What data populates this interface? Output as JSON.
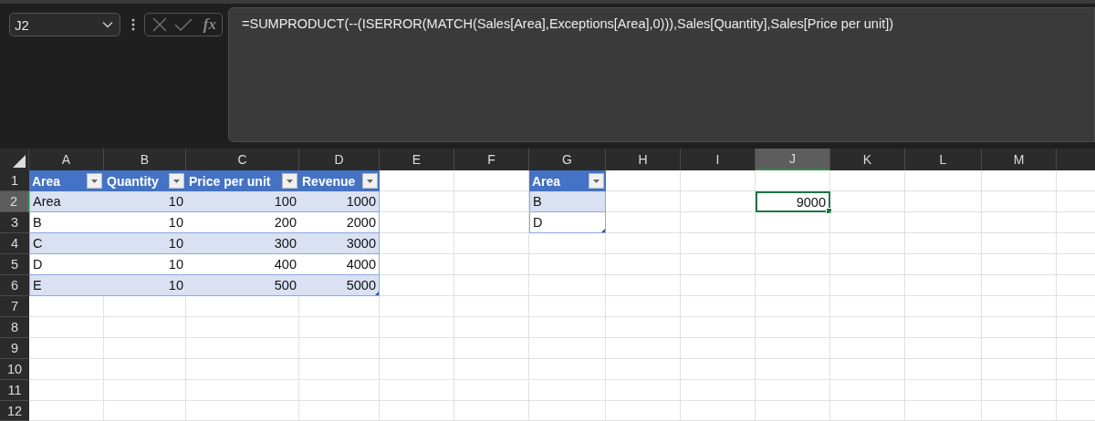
{
  "formula_bar": {
    "name_box": "J2",
    "function_label": "fx",
    "formula": "=SUMPRODUCT(--(ISERROR(MATCH(Sales[Area],Exceptions[Area],0))),Sales[Quantity],Sales[Price per unit])"
  },
  "sheet": {
    "columns": [
      {
        "label": "A",
        "selected": false
      },
      {
        "label": "B",
        "selected": false
      },
      {
        "label": "C",
        "selected": false
      },
      {
        "label": "D",
        "selected": false
      },
      {
        "label": "E",
        "selected": false
      },
      {
        "label": "F",
        "selected": false
      },
      {
        "label": "G",
        "selected": false
      },
      {
        "label": "H",
        "selected": false
      },
      {
        "label": "I",
        "selected": false
      },
      {
        "label": "J",
        "selected": true
      },
      {
        "label": "K",
        "selected": false
      },
      {
        "label": "L",
        "selected": false
      },
      {
        "label": "M",
        "selected": false
      },
      {
        "selected": false
      }
    ],
    "rows": [
      {
        "label": "1",
        "selected": false,
        "cells": [
          {
            "kind": "header",
            "text": "Area",
            "selected": false
          },
          {
            "kind": "header",
            "text": "Quantity",
            "selected": false
          },
          {
            "kind": "header",
            "text": "Price per unit",
            "selected": false
          },
          {
            "kind": "header",
            "text": "Revenue",
            "selected": false
          },
          {
            "kind": "blank",
            "selected": false
          },
          {
            "kind": "blank",
            "selected": false
          },
          {
            "kind": "header",
            "text": "Area",
            "selected": false
          },
          {
            "kind": "blank",
            "selected": false
          },
          {
            "kind": "blank",
            "selected": false
          },
          {
            "kind": "blank",
            "selected": false
          },
          {
            "kind": "blank",
            "selected": false
          },
          {
            "kind": "blank",
            "selected": false
          },
          {
            "kind": "blank",
            "selected": false
          },
          {
            "kind": "blank",
            "selected": false
          }
        ]
      },
      {
        "label": "2",
        "selected": true,
        "cells": [
          {
            "kind": "text",
            "text": "Area",
            "band": true,
            "selected": false
          },
          {
            "kind": "number",
            "text": "10",
            "band": true,
            "selected": false
          },
          {
            "kind": "number",
            "text": "100",
            "band": true,
            "selected": false
          },
          {
            "kind": "number",
            "text": "1000",
            "band": true,
            "selected": false
          },
          {
            "kind": "blank",
            "selected": false
          },
          {
            "kind": "blank",
            "selected": false
          },
          {
            "kind": "text",
            "text": "B",
            "band": true,
            "selected": false
          },
          {
            "kind": "blank",
            "selected": false
          },
          {
            "kind": "blank",
            "selected": false
          },
          {
            "kind": "number",
            "text": "9000",
            "selected": true
          },
          {
            "kind": "blank",
            "selected": false
          },
          {
            "kind": "blank",
            "selected": false
          },
          {
            "kind": "blank",
            "selected": false
          },
          {
            "kind": "blank",
            "selected": false
          }
        ]
      },
      {
        "label": "3",
        "selected": false,
        "cells": [
          {
            "kind": "text",
            "text": "B",
            "band": false,
            "selected": false
          },
          {
            "kind": "number",
            "text": "10",
            "band": false,
            "selected": false
          },
          {
            "kind": "number",
            "text": "200",
            "band": false,
            "selected": false
          },
          {
            "kind": "number",
            "text": "2000",
            "band": false,
            "selected": false
          },
          {
            "kind": "blank",
            "selected": false
          },
          {
            "kind": "blank",
            "selected": false
          },
          {
            "kind": "text",
            "text": "D",
            "band": false,
            "selected": false
          },
          {
            "kind": "blank",
            "selected": false
          },
          {
            "kind": "blank",
            "selected": false
          },
          {
            "kind": "blank",
            "selected": false
          },
          {
            "kind": "blank",
            "selected": false
          },
          {
            "kind": "blank",
            "selected": false
          },
          {
            "kind": "blank",
            "selected": false
          },
          {
            "kind": "blank",
            "selected": false
          }
        ]
      },
      {
        "label": "4",
        "selected": false,
        "cells": [
          {
            "kind": "text",
            "text": "C",
            "band": true,
            "selected": false
          },
          {
            "kind": "number",
            "text": "10",
            "band": true,
            "selected": false
          },
          {
            "kind": "number",
            "text": "300",
            "band": true,
            "selected": false
          },
          {
            "kind": "number",
            "text": "3000",
            "band": true,
            "selected": false
          },
          {
            "kind": "blank",
            "selected": false
          },
          {
            "kind": "blank",
            "selected": false
          },
          {
            "kind": "blank",
            "selected": false
          },
          {
            "kind": "blank",
            "selected": false
          },
          {
            "kind": "blank",
            "selected": false
          },
          {
            "kind": "blank",
            "selected": false
          },
          {
            "kind": "blank",
            "selected": false
          },
          {
            "kind": "blank",
            "selected": false
          },
          {
            "kind": "blank",
            "selected": false
          },
          {
            "kind": "blank",
            "selected": false
          }
        ]
      },
      {
        "label": "5",
        "selected": false,
        "cells": [
          {
            "kind": "text",
            "text": "D",
            "band": false,
            "selected": false
          },
          {
            "kind": "number",
            "text": "10",
            "band": false,
            "selected": false
          },
          {
            "kind": "number",
            "text": "400",
            "band": false,
            "selected": false
          },
          {
            "kind": "number",
            "text": "4000",
            "band": false,
            "selected": false
          },
          {
            "kind": "blank",
            "selected": false
          },
          {
            "kind": "blank",
            "selected": false
          },
          {
            "kind": "blank",
            "selected": false
          },
          {
            "kind": "blank",
            "selected": false
          },
          {
            "kind": "blank",
            "selected": false
          },
          {
            "kind": "blank",
            "selected": false
          },
          {
            "kind": "blank",
            "selected": false
          },
          {
            "kind": "blank",
            "selected": false
          },
          {
            "kind": "blank",
            "selected": false
          },
          {
            "kind": "blank",
            "selected": false
          }
        ]
      },
      {
        "label": "6",
        "selected": false,
        "cells": [
          {
            "kind": "text",
            "text": "E",
            "band": true,
            "selected": false
          },
          {
            "kind": "number",
            "text": "10",
            "band": true,
            "selected": false
          },
          {
            "kind": "number",
            "text": "500",
            "band": true,
            "selected": false
          },
          {
            "kind": "number",
            "text": "5000",
            "band": true,
            "selected": false
          },
          {
            "kind": "blank",
            "selected": false
          },
          {
            "kind": "blank",
            "selected": false
          },
          {
            "kind": "blank",
            "selected": false
          },
          {
            "kind": "blank",
            "selected": false
          },
          {
            "kind": "blank",
            "selected": false
          },
          {
            "kind": "blank",
            "selected": false
          },
          {
            "kind": "blank",
            "selected": false
          },
          {
            "kind": "blank",
            "selected": false
          },
          {
            "kind": "blank",
            "selected": false
          },
          {
            "kind": "blank",
            "selected": false
          }
        ]
      },
      {
        "label": "7",
        "selected": false,
        "cells": [
          {
            "kind": "blank",
            "selected": false
          },
          {
            "kind": "blank",
            "selected": false
          },
          {
            "kind": "blank",
            "selected": false
          },
          {
            "kind": "blank",
            "selected": false
          },
          {
            "kind": "blank",
            "selected": false
          },
          {
            "kind": "blank",
            "selected": false
          },
          {
            "kind": "blank",
            "selected": false
          },
          {
            "kind": "blank",
            "selected": false
          },
          {
            "kind": "blank",
            "selected": false
          },
          {
            "kind": "blank",
            "selected": false
          },
          {
            "kind": "blank",
            "selected": false
          },
          {
            "kind": "blank",
            "selected": false
          },
          {
            "kind": "blank",
            "selected": false
          },
          {
            "kind": "blank",
            "selected": false
          }
        ]
      },
      {
        "label": "8",
        "selected": false,
        "cells": [
          {
            "kind": "blank",
            "selected": false
          },
          {
            "kind": "blank",
            "selected": false
          },
          {
            "kind": "blank",
            "selected": false
          },
          {
            "kind": "blank",
            "selected": false
          },
          {
            "kind": "blank",
            "selected": false
          },
          {
            "kind": "blank",
            "selected": false
          },
          {
            "kind": "blank",
            "selected": false
          },
          {
            "kind": "blank",
            "selected": false
          },
          {
            "kind": "blank",
            "selected": false
          },
          {
            "kind": "blank",
            "selected": false
          },
          {
            "kind": "blank",
            "selected": false
          },
          {
            "kind": "blank",
            "selected": false
          },
          {
            "kind": "blank",
            "selected": false
          },
          {
            "kind": "blank",
            "selected": false
          }
        ]
      },
      {
        "label": "9",
        "selected": false,
        "cells": [
          {
            "kind": "blank",
            "selected": false
          },
          {
            "kind": "blank",
            "selected": false
          },
          {
            "kind": "blank",
            "selected": false
          },
          {
            "kind": "blank",
            "selected": false
          },
          {
            "kind": "blank",
            "selected": false
          },
          {
            "kind": "blank",
            "selected": false
          },
          {
            "kind": "blank",
            "selected": false
          },
          {
            "kind": "blank",
            "selected": false
          },
          {
            "kind": "blank",
            "selected": false
          },
          {
            "kind": "blank",
            "selected": false
          },
          {
            "kind": "blank",
            "selected": false
          },
          {
            "kind": "blank",
            "selected": false
          },
          {
            "kind": "blank",
            "selected": false
          },
          {
            "kind": "blank",
            "selected": false
          }
        ]
      },
      {
        "label": "10",
        "selected": false,
        "cells": [
          {
            "kind": "blank",
            "selected": false
          },
          {
            "kind": "blank",
            "selected": false
          },
          {
            "kind": "blank",
            "selected": false
          },
          {
            "kind": "blank",
            "selected": false
          },
          {
            "kind": "blank",
            "selected": false
          },
          {
            "kind": "blank",
            "selected": false
          },
          {
            "kind": "blank",
            "selected": false
          },
          {
            "kind": "blank",
            "selected": false
          },
          {
            "kind": "blank",
            "selected": false
          },
          {
            "kind": "blank",
            "selected": false
          },
          {
            "kind": "blank",
            "selected": false
          },
          {
            "kind": "blank",
            "selected": false
          },
          {
            "kind": "blank",
            "selected": false
          },
          {
            "kind": "blank",
            "selected": false
          }
        ]
      },
      {
        "label": "11",
        "selected": false,
        "cells": [
          {
            "kind": "blank",
            "selected": false
          },
          {
            "kind": "blank",
            "selected": false
          },
          {
            "kind": "blank",
            "selected": false
          },
          {
            "kind": "blank",
            "selected": false
          },
          {
            "kind": "blank",
            "selected": false
          },
          {
            "kind": "blank",
            "selected": false
          },
          {
            "kind": "blank",
            "selected": false
          },
          {
            "kind": "blank",
            "selected": false
          },
          {
            "kind": "blank",
            "selected": false
          },
          {
            "kind": "blank",
            "selected": false
          },
          {
            "kind": "blank",
            "selected": false
          },
          {
            "kind": "blank",
            "selected": false
          },
          {
            "kind": "blank",
            "selected": false
          },
          {
            "kind": "blank",
            "selected": false
          }
        ]
      },
      {
        "label": "12",
        "selected": false,
        "cells": [
          {
            "kind": "blank",
            "selected": false
          },
          {
            "kind": "blank",
            "selected": false
          },
          {
            "kind": "blank",
            "selected": false
          },
          {
            "kind": "blank",
            "selected": false
          },
          {
            "kind": "blank",
            "selected": false
          },
          {
            "kind": "blank",
            "selected": false
          },
          {
            "kind": "blank",
            "selected": false
          },
          {
            "kind": "blank",
            "selected": false
          },
          {
            "kind": "blank",
            "selected": false
          },
          {
            "kind": "blank",
            "selected": false
          },
          {
            "kind": "blank",
            "selected": false
          },
          {
            "kind": "blank",
            "selected": false
          },
          {
            "kind": "blank",
            "selected": false
          },
          {
            "kind": "blank",
            "selected": false
          }
        ]
      }
    ]
  }
}
